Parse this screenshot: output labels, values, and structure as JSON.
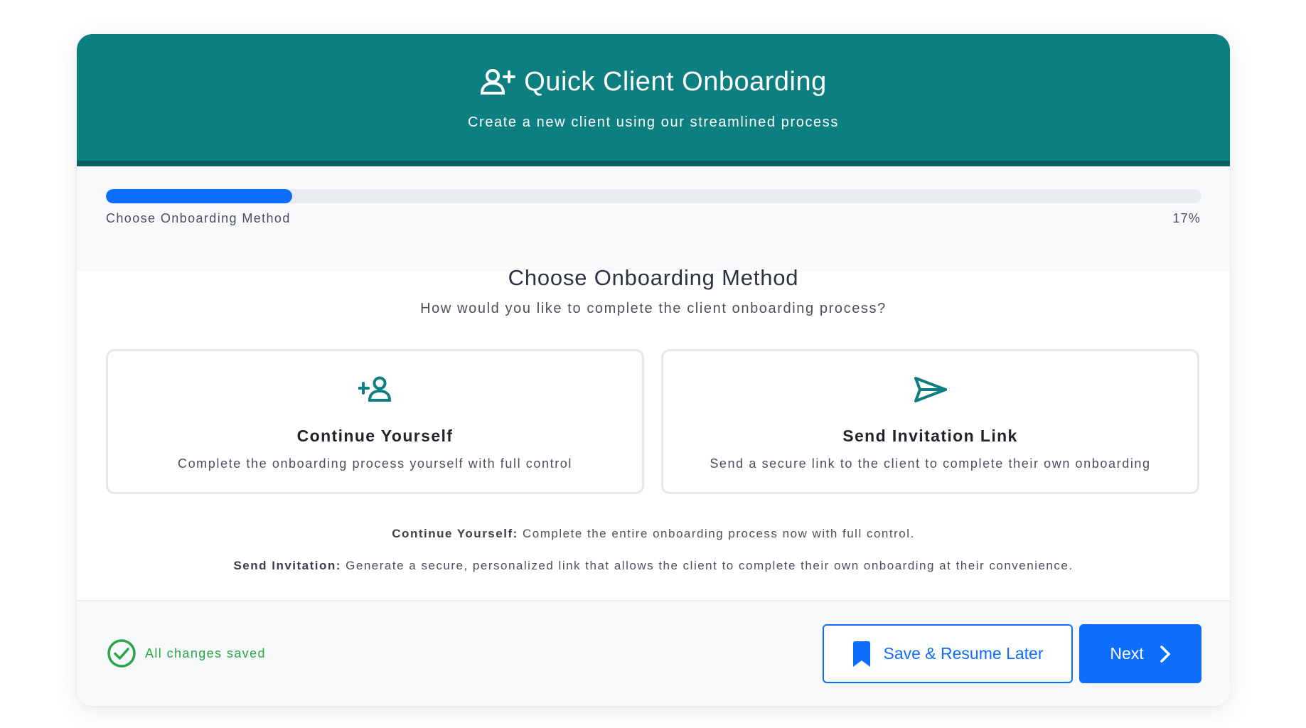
{
  "header": {
    "icon": "user-plus-icon",
    "title": "Quick Client Onboarding",
    "subtitle": "Create a new client using our streamlined process"
  },
  "progress": {
    "step_label": "Choose Onboarding Method",
    "percent_label": "17%",
    "value": 0.17
  },
  "main": {
    "title": "Choose Onboarding Method",
    "subtitle": "How would you like to complete the client onboarding process?"
  },
  "options": [
    {
      "icon": "user-plus-icon",
      "title": "Continue Yourself",
      "description": "Complete the onboarding process yourself with full control"
    },
    {
      "icon": "paper-plane-icon",
      "title": "Send Invitation Link",
      "description": "Send a secure link to the client to complete their own onboarding"
    }
  ],
  "info": [
    {
      "label": "Continue Yourself:",
      "text": "Complete the entire onboarding process now with full control."
    },
    {
      "label": "Send Invitation:",
      "text": "Generate a secure, personalized link that allows the client to complete their own onboarding at their convenience."
    }
  ],
  "footer": {
    "status_icon": "check-circle-icon",
    "status_text": "All changes saved",
    "save_button_icon": "bookmark-icon",
    "save_button_label": "Save & Resume Later",
    "next_button_label": "Next",
    "next_button_icon": "chevron-right-icon"
  },
  "colors": {
    "header_bg": "#0d7f80",
    "header_border": "#0a5f60",
    "primary": "#0d6efd",
    "success": "#28a745",
    "icon_teal": "#0d7f80"
  }
}
